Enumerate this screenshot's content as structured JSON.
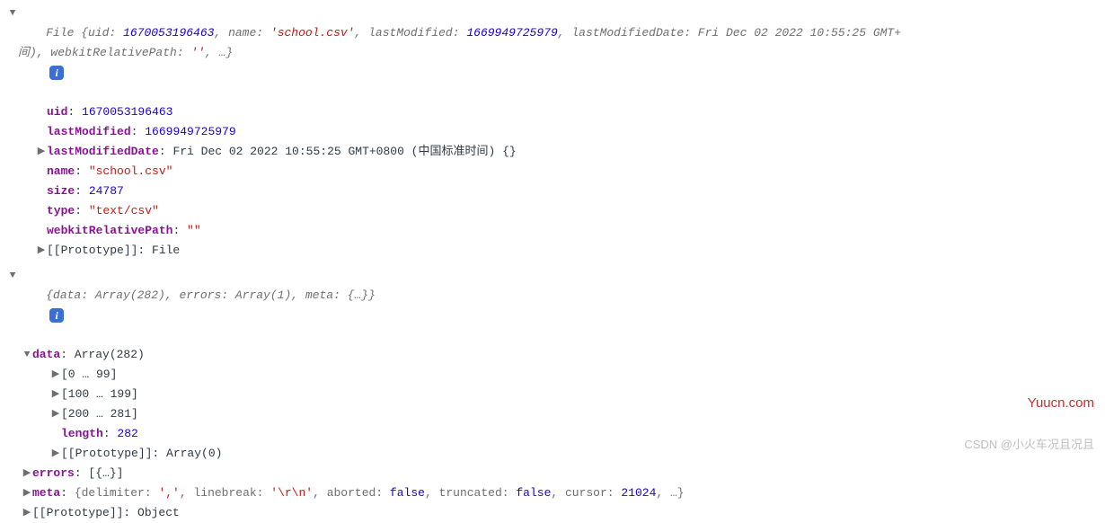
{
  "fileHeader": {
    "prefix": "File {uid: ",
    "uid": "1670053196463",
    "nameLabel": ", name: ",
    "name": "'school.csv'",
    "lmLabel": ", lastModified: ",
    "lm": "1669949725979",
    "lmdLabel": ", lastModifiedDate: ",
    "lmd1": "Fri Dec 02 2022 10:55:25 GMT+",
    "lmd2": "间)",
    "wrpLabel": ", webkitRelativePath: ",
    "wrp": "''",
    "suffix": ", …}"
  },
  "file": {
    "uidKey": "uid",
    "uidVal": "1670053196463",
    "lmKey": "lastModified",
    "lmVal": "1669949725979",
    "lmdKey": "lastModifiedDate",
    "lmdVal": "Fri Dec 02 2022 10:55:25 GMT+0800 (中国标准时间) {}",
    "nameKey": "name",
    "nameVal": "\"school.csv\"",
    "sizeKey": "size",
    "sizeVal": "24787",
    "typeKey": "type",
    "typeVal": "\"text/csv\"",
    "wrpKey": "webkitRelativePath",
    "wrpVal": "\"\"",
    "protoKey": "[[Prototype]]",
    "protoVal": "File"
  },
  "obj2Header": "{data: Array(282), errors: Array(1), meta: {…}}",
  "obj2": {
    "dataKey": "data",
    "dataVal": "Array(282)",
    "range0": "[0 … 99]",
    "range1": "[100 … 199]",
    "range2": "[200 … 281]",
    "lenKey": "length",
    "lenVal": "282",
    "dataProtoKey": "[[Prototype]]",
    "dataProtoVal": "Array(0)",
    "errorsKey": "errors",
    "errorsVal": "[{…}]",
    "metaKey": "meta",
    "metaPrefix": "{delimiter: ",
    "metaDelim": "','",
    "metaLbLabel": ", linebreak: ",
    "metaLb": "'\\r\\n'",
    "metaAbortLabel": ", aborted: ",
    "metaAbort": "false",
    "metaTruncLabel": ", truncated: ",
    "metaTrunc": "false",
    "metaCursorLabel": ", cursor: ",
    "metaCursor": "21024",
    "metaSuffix": ", …}",
    "protoKey": "[[Prototype]]",
    "protoVal": "Object"
  },
  "watermark1": "Yuucn.com",
  "watermark2": "CSDN @小火车况且况且"
}
